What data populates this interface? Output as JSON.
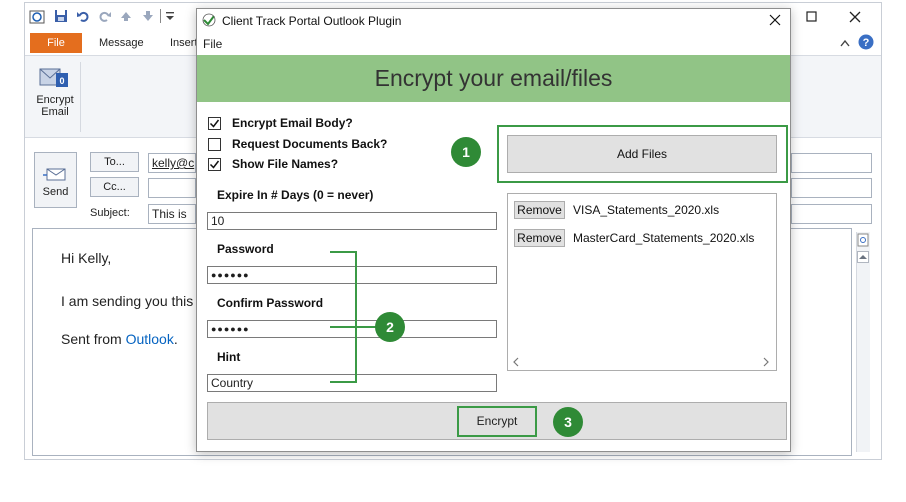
{
  "outlook": {
    "tabs": [
      "File",
      "Message",
      "Insert"
    ],
    "encrypt_label_1": "Encrypt",
    "encrypt_label_2": "Email",
    "send_label": "Send",
    "to_label": "To...",
    "cc_label": "Cc...",
    "subject_label": "Subject:",
    "to_value": "kelly@c",
    "subject_value": "This is",
    "body_greeting": "Hi Kelly,",
    "body_line": "I am sending you this",
    "body_sent_prefix": "Sent from ",
    "body_sent_link": "Outlook",
    "body_sent_suffix": "."
  },
  "dialog": {
    "title": "Client Track Portal Outlook Plugin",
    "menu_file": "File",
    "banner": "Encrypt your email/files",
    "checkboxes": [
      {
        "label": "Encrypt Email Body?",
        "checked": true
      },
      {
        "label": "Request Documents Back?",
        "checked": false
      },
      {
        "label": "Show File Names?",
        "checked": true
      }
    ],
    "expire_label": "Expire In # Days (0 = never)",
    "expire_value": "10",
    "password_label": "Password",
    "password_value": "●●●●●●",
    "confirm_label": "Confirm Password",
    "confirm_value": "●●●●●●",
    "hint_label": "Hint",
    "hint_value": "Country",
    "add_files_label": "Add Files",
    "files": [
      {
        "remove_label": "Remove",
        "name": "VISA_Statements_2020.xls"
      },
      {
        "remove_label": "Remove",
        "name": "MasterCard_Statements_2020.xls"
      }
    ],
    "encrypt_button": "Encrypt"
  },
  "badges": [
    "1",
    "2",
    "3"
  ],
  "colors": {
    "banner": "#91c486",
    "badge": "#2f8a36",
    "outline": "#3b9a46",
    "file_tab": "#e46e1e"
  },
  "icons": [
    "save-icon",
    "undo-icon",
    "redo-icon",
    "arrow-up-icon",
    "arrow-down-icon",
    "minimize-icon",
    "maximize-icon",
    "close-icon",
    "help-icon",
    "send-icon",
    "encrypt-email-icon",
    "app-icon",
    "checkmark-icon",
    "scroll-left-icon",
    "scroll-right-icon"
  ]
}
